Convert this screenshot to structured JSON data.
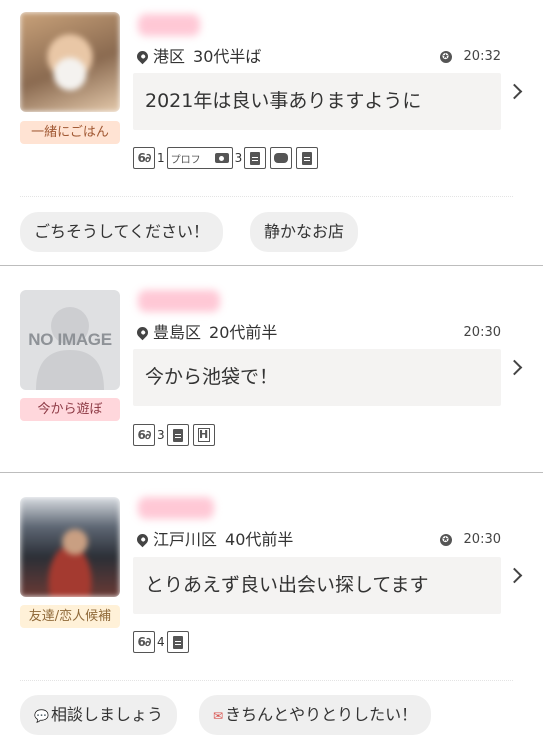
{
  "cards": [
    {
      "tag": "一緒にごはん",
      "area": "港区",
      "age": "30代半ば",
      "time_mark": "✪",
      "time": "20:32",
      "message": "2021年は良い事ありますように",
      "views_count": "1",
      "prof_label": "プロフ",
      "photos_count": "3",
      "tags": [
        "ごちそうしてください！",
        "静かなお店"
      ]
    },
    {
      "tag": "今から遊ぼ",
      "area": "豊島区",
      "age": "20代前半",
      "time": "20:30",
      "message": "今から池袋で！",
      "views_count": "3",
      "noimage_text": "NO IMAGE"
    },
    {
      "tag": "友達/恋人候補",
      "area": "江戸川区",
      "age": "40代前半",
      "time_mark": "✪",
      "time": "20:30",
      "message": "とりあえず良い出会い探してます",
      "views_count": "4",
      "tags": [
        "相談しましょう",
        "きちんとやりとりしたい！"
      ]
    }
  ],
  "colors": {
    "tag_orange_bg": "#ffe3d3",
    "tag_pink_bg": "#ffd7dc",
    "tag_yellow_bg": "#fff1d8",
    "message_bg": "#f4f3f2",
    "chip_bg": "#efefef"
  },
  "icons": [
    "location-pin-icon",
    "star-badge-icon",
    "glasses-icon",
    "camera-icon",
    "document-icon",
    "chat-bubble-icon",
    "memo-icon",
    "hotel-icon",
    "chevron-right-icon",
    "speech-bubble-icon",
    "envelope-icon"
  ]
}
